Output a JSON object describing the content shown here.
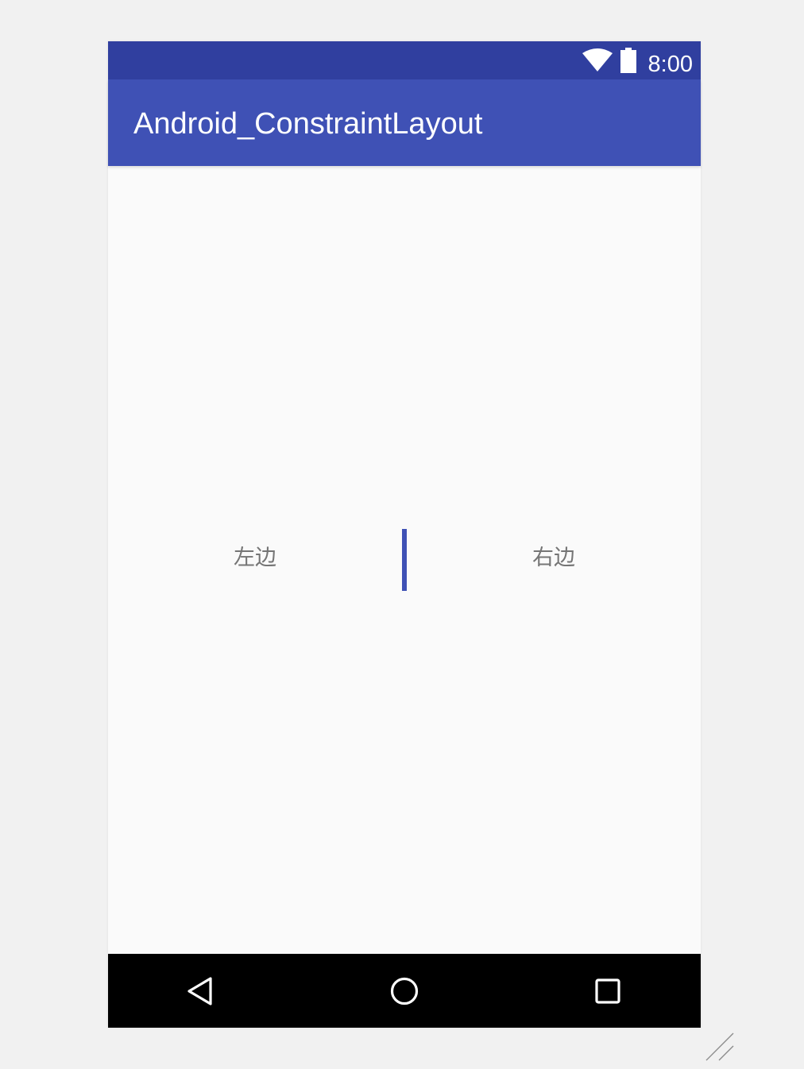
{
  "status_bar": {
    "time": "8:00",
    "wifi_icon": "wifi-icon",
    "battery_icon": "battery-icon"
  },
  "app_bar": {
    "title": "Android_ConstraintLayout"
  },
  "content": {
    "left_text": "左边",
    "right_text": "右边"
  },
  "nav_bar": {
    "back_icon": "back-triangle-icon",
    "home_icon": "home-circle-icon",
    "recents_icon": "recents-square-icon"
  },
  "colors": {
    "status_bar": "#303f9f",
    "app_bar": "#3f51b5",
    "accent": "#3f51b5",
    "background": "#fafafa",
    "text_secondary": "#757575",
    "nav_bar": "#000000"
  }
}
